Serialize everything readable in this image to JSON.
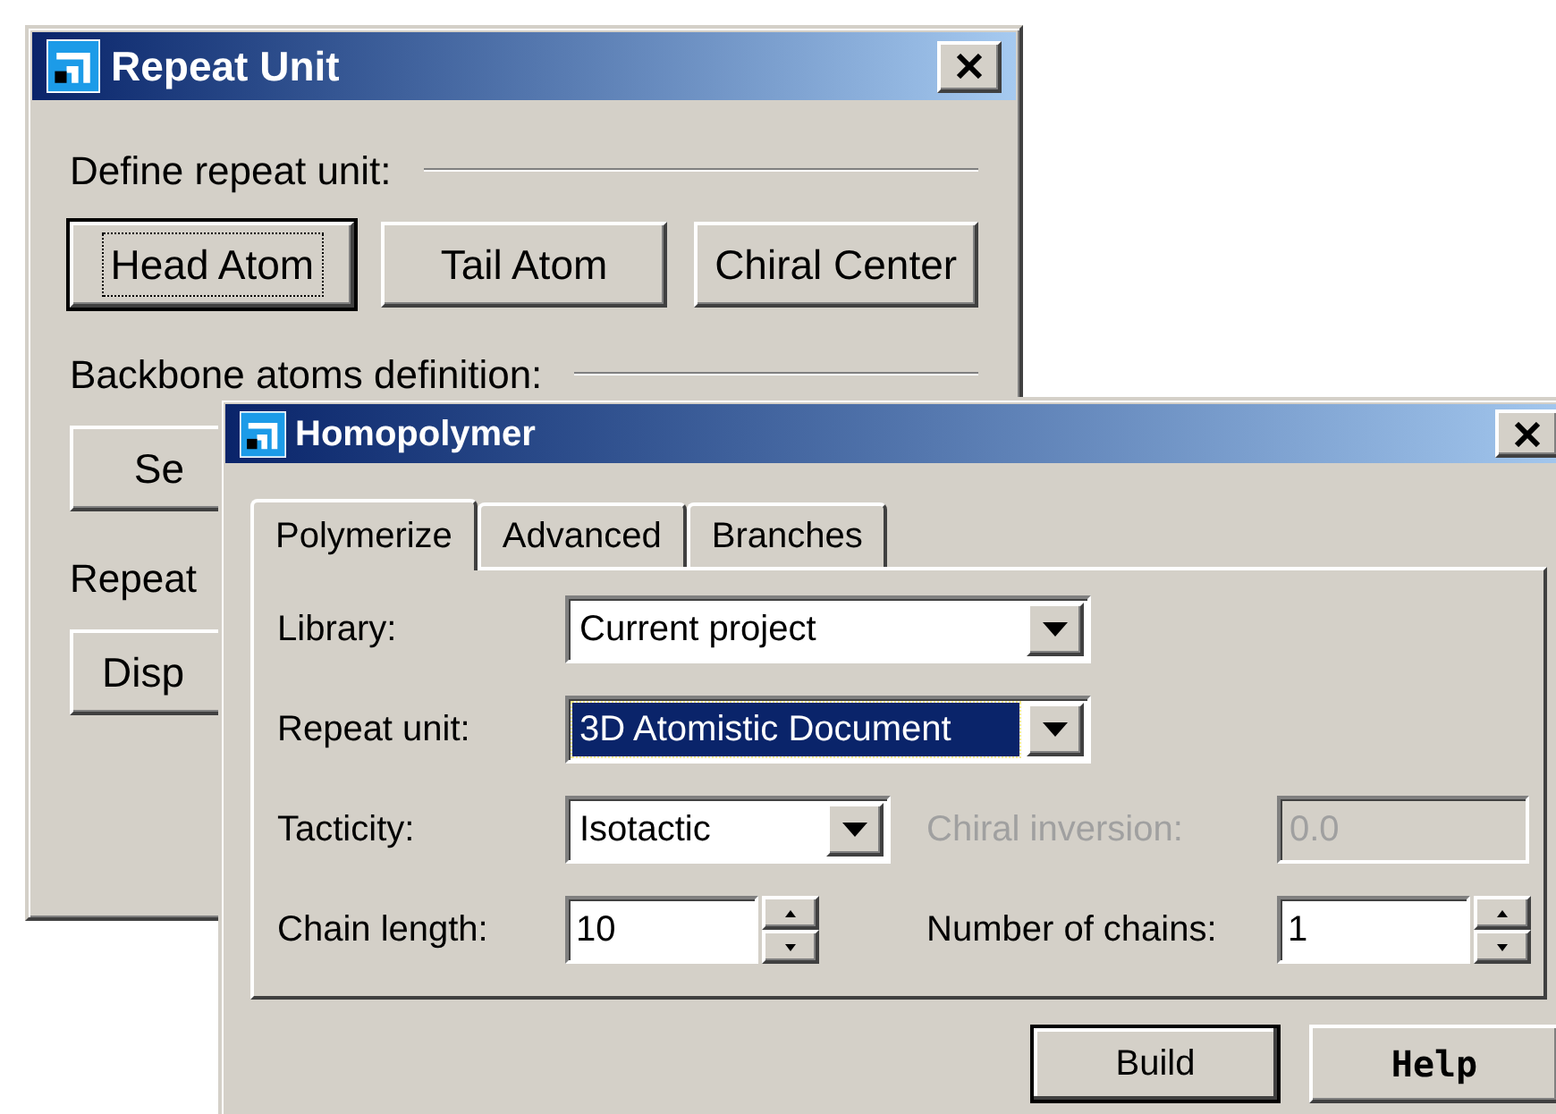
{
  "repeat_unit_window": {
    "title": "Repeat Unit",
    "sections": [
      {
        "label": "Define repeat unit:",
        "buttons": [
          {
            "label": "Head Atom",
            "focused": true
          },
          {
            "label": "Tail Atom",
            "focused": false
          },
          {
            "label": "Chiral Center",
            "focused": false
          }
        ]
      },
      {
        "label": "Backbone atoms definition:",
        "buttons": [
          {
            "label": "Se",
            "focused": false
          }
        ]
      },
      {
        "label": "Repeat",
        "buttons": [
          {
            "label": "Disp",
            "focused": false
          }
        ]
      }
    ]
  },
  "homopolymer_window": {
    "title": "Homopolymer",
    "tabs": [
      {
        "label": "Polymerize",
        "selected": true
      },
      {
        "label": "Advanced",
        "selected": false
      },
      {
        "label": "Branches",
        "selected": false
      }
    ],
    "rows": [
      [
        {
          "kind": "combo",
          "label": "Library:",
          "value": "Current project",
          "highlighted": false
        }
      ],
      [
        {
          "kind": "combo",
          "label": "Repeat unit:",
          "value": "3D Atomistic Document",
          "highlighted": true
        }
      ],
      [
        {
          "kind": "combo",
          "label": "Tacticity:",
          "value": "Isotactic",
          "highlighted": false
        },
        {
          "kind": "text",
          "label": "Chiral inversion:",
          "value": "0.0",
          "disabled": true
        }
      ],
      [
        {
          "kind": "spin",
          "label": "Chain length:",
          "value": "10"
        },
        {
          "kind": "spin",
          "label": "Number of chains:",
          "value": "1"
        }
      ]
    ],
    "buttons": [
      "Build",
      "Help"
    ]
  }
}
